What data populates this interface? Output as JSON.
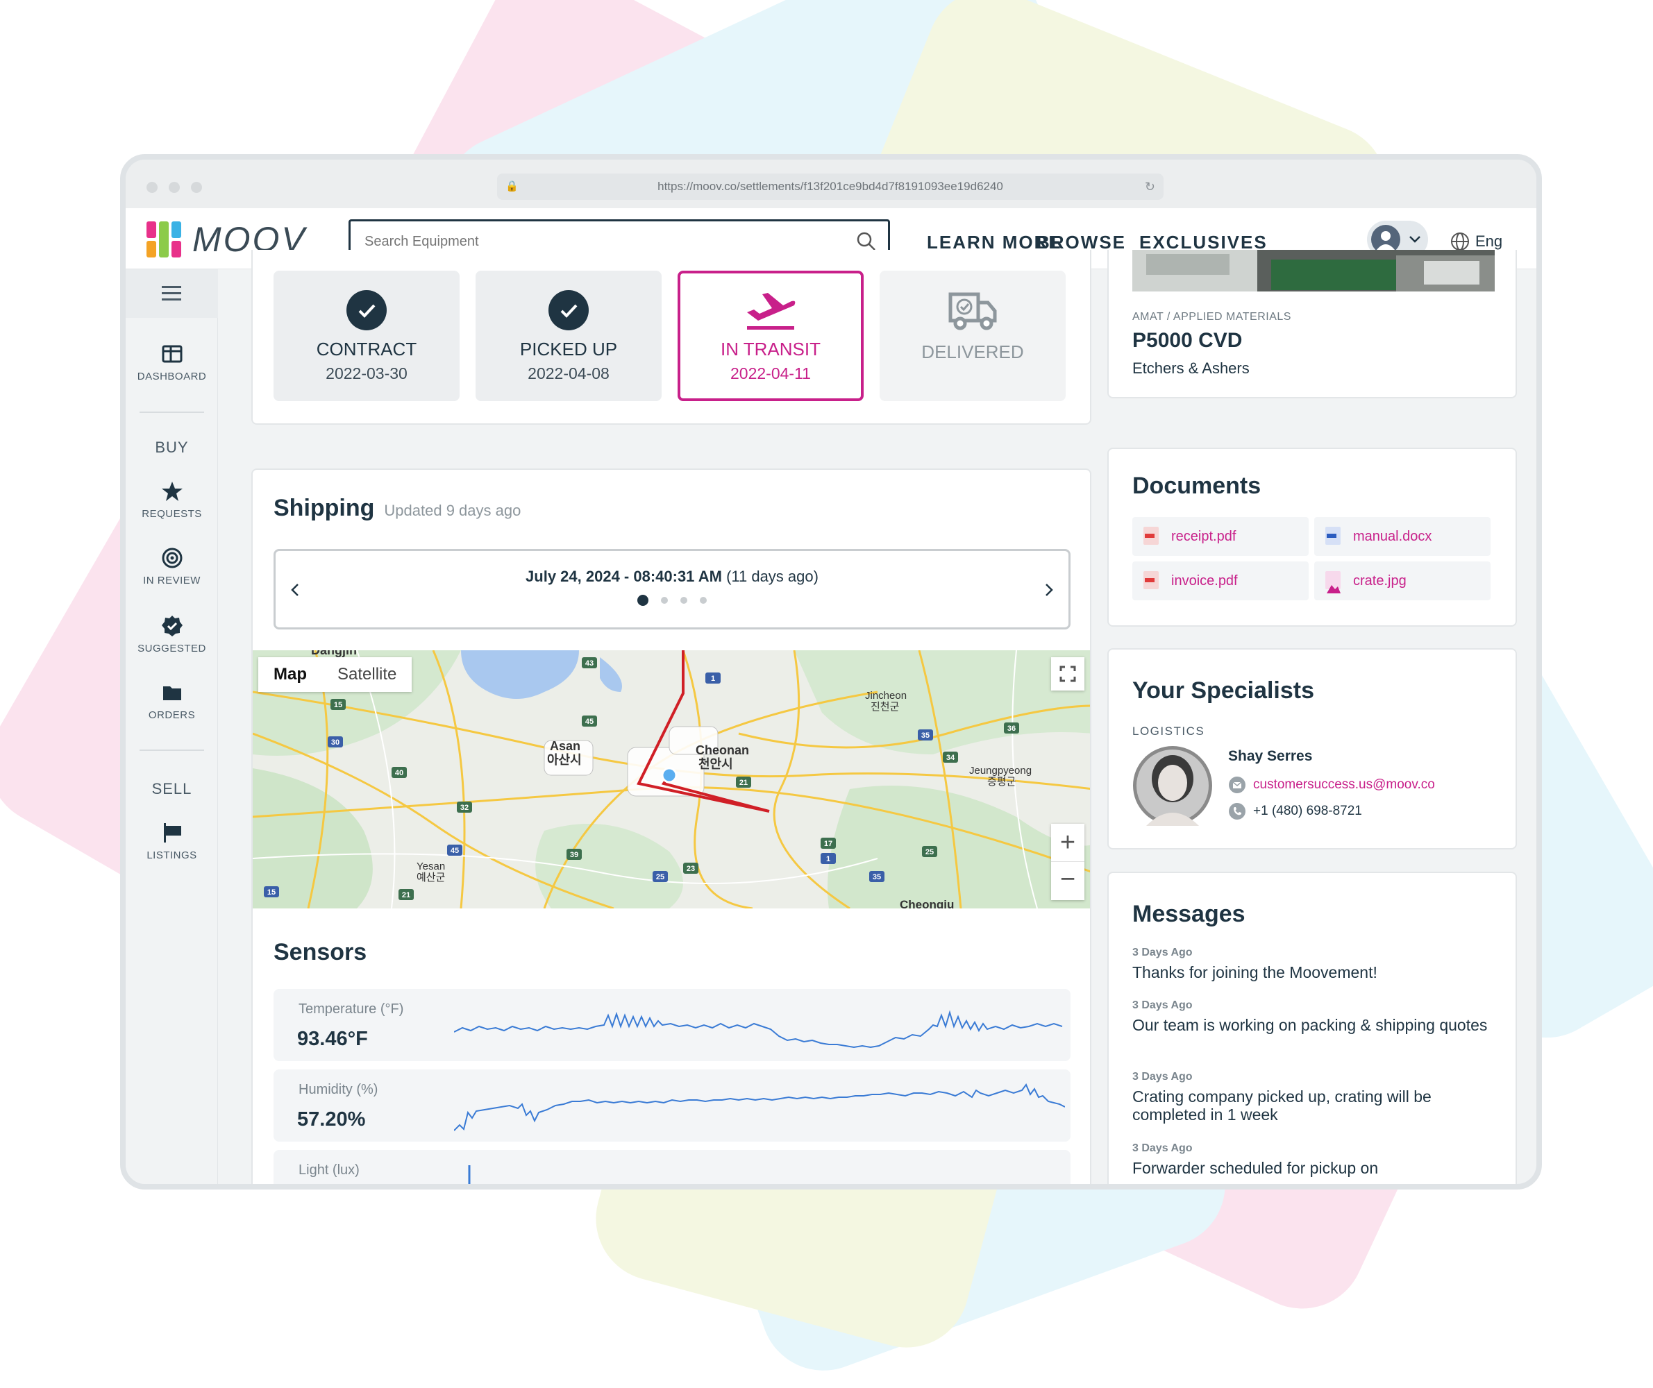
{
  "browser": {
    "url": "https://moov.co/settlements/f13f201ce9bd4d7f8191093ee19d6240"
  },
  "header": {
    "logo_text": "MOOV",
    "search_placeholder": "Search Equipment",
    "nav": [
      "LEARN MORE",
      "BROWSE",
      "EXCLUSIVES"
    ],
    "language": "Eng"
  },
  "sidebar": {
    "dashboard": "DASHBOARD",
    "buy_heading": "BUY",
    "requests": "REQUESTS",
    "in_review": "IN REVIEW",
    "suggested": "SUGGESTED",
    "orders": "ORDERS",
    "sell_heading": "SELL",
    "listings": "LISTINGS"
  },
  "progress": {
    "steps": [
      {
        "label": "CONTRACT",
        "date": "2022-03-30",
        "state": "done"
      },
      {
        "label": "PICKED UP",
        "date": "2022-04-08",
        "state": "done"
      },
      {
        "label": "IN TRANSIT",
        "date": "2022-04-11",
        "state": "active"
      },
      {
        "label": "DELIVERED",
        "date": "",
        "state": "pending"
      }
    ]
  },
  "shipping": {
    "title": "Shipping",
    "updated": "Updated 9 days ago",
    "date_main": "July 24, 2024 - 08:40:31 AM",
    "date_rel": "(11 days ago)",
    "map_tab_map": "Map",
    "map_tab_satellite": "Satellite",
    "map_labels": [
      "Dangjin",
      "Asan",
      "아산시",
      "Cheonan",
      "천안시",
      "Jincheon",
      "진천군",
      "Jeungpyeong",
      "증평군",
      "Yesan",
      "예산군",
      "Cheongju"
    ],
    "route_numbers": [
      "43",
      "1",
      "15",
      "30",
      "45",
      "40",
      "34",
      "36",
      "35",
      "21",
      "32",
      "39",
      "25",
      "23",
      "17",
      "45",
      "15",
      "21",
      "25",
      "35",
      "1"
    ]
  },
  "sensors": {
    "title": "Sensors",
    "rows": [
      {
        "label": "Temperature (°F)",
        "value": "93.46°F"
      },
      {
        "label": "Humidity (%)",
        "value": "57.20%"
      },
      {
        "label": "Light (lux)",
        "value": ""
      }
    ],
    "line_color": "#3a7bd5"
  },
  "listing": {
    "brand": "AMAT / APPLIED MATERIALS",
    "model": "P5000 CVD",
    "category": "Etchers & Ashers"
  },
  "documents": {
    "title": "Documents",
    "files": [
      {
        "name": "receipt.pdf",
        "type": "pdf"
      },
      {
        "name": "manual.docx",
        "type": "docx"
      },
      {
        "name": "invoice.pdf",
        "type": "pdf"
      },
      {
        "name": "crate.jpg",
        "type": "jpg"
      }
    ]
  },
  "specialists": {
    "title": "Your Specialists",
    "role": "LOGISTICS",
    "name": "Shay Serres",
    "email": "customersuccess.us@moov.co",
    "phone": "+1 (480) 698-8721"
  },
  "messages": {
    "title": "Messages",
    "items": [
      {
        "time": "3 Days Ago",
        "text": "Thanks for joining the Moovement!"
      },
      {
        "time": "3 Days Ago",
        "text": "Our team is working on packing & shipping quotes"
      },
      {
        "time": "3 Days Ago",
        "text": "Crating company picked up, crating will be completed in 1 week"
      },
      {
        "time": "3 Days Ago",
        "text": "Forwarder scheduled for pickup on"
      }
    ]
  },
  "colors": {
    "accent": "#c8208a",
    "navy": "#1f3442",
    "route": "#d01f26"
  }
}
